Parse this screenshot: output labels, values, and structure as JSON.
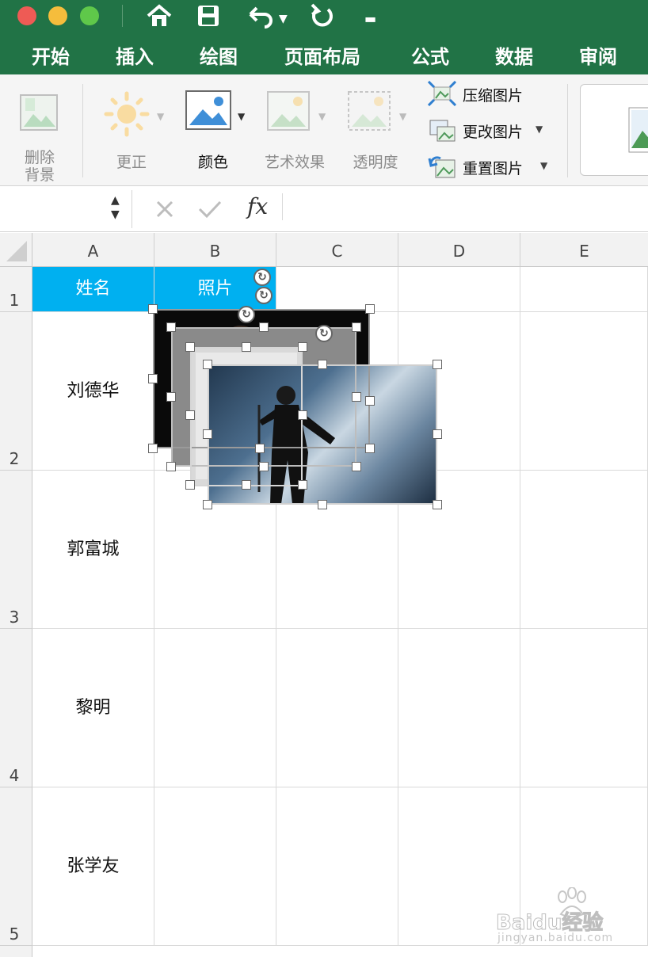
{
  "window": {
    "traffic_colors": [
      "#ee5b55",
      "#f5bd3c",
      "#5fc84a"
    ],
    "quick_access_icons": [
      "home-icon",
      "save-icon",
      "undo-icon",
      "redo-icon",
      "customize-icon"
    ]
  },
  "tabs": [
    "开始",
    "插入",
    "绘图",
    "页面布局",
    "公式",
    "数据",
    "审阅"
  ],
  "ribbon": {
    "remove_bg_line1": "删除",
    "remove_bg_line2": "背景",
    "corrections": "更正",
    "color": "颜色",
    "artistic": "艺术效果",
    "transparency": "透明度",
    "compress": "压缩图片",
    "change": "更改图片",
    "reset": "重置图片"
  },
  "formula_bar": {
    "fx": "fx",
    "cancel_icon": "x-icon",
    "confirm_icon": "check-icon"
  },
  "sheet": {
    "columns": [
      "A",
      "B",
      "C",
      "D",
      "E"
    ],
    "rows": [
      "1",
      "2",
      "3",
      "4",
      "5"
    ],
    "header_row": [
      "姓名",
      "照片"
    ],
    "names": [
      "刘德华",
      "郭富城",
      "黎明",
      "张学友"
    ],
    "header_fill": "#00b0f0"
  },
  "watermark": {
    "brand": "Baidu经验",
    "url": "jingyan.baidu.com"
  }
}
